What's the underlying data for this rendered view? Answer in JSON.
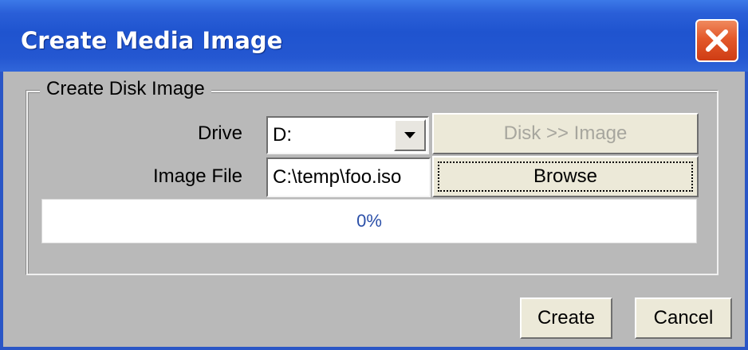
{
  "window": {
    "title": "Create Media Image",
    "title_color": "#ffffff",
    "titlebar_color": "#2a5fd8",
    "close_button_color": "#e3582a"
  },
  "group": {
    "legend": "Create Disk Image"
  },
  "drive": {
    "label": "Drive",
    "selected_value": "D:",
    "action_button_label": "Disk >> Image",
    "action_button_enabled": false
  },
  "image_file": {
    "label": "Image File",
    "value": "C:\\temp\\foo.iso",
    "browse_label": "Browse"
  },
  "progress": {
    "text": "0%",
    "fraction": 0
  },
  "footer": {
    "create_label": "Create",
    "cancel_label": "Cancel"
  },
  "icons": {
    "close": "close-icon",
    "dropdown": "chevron-down-icon"
  }
}
